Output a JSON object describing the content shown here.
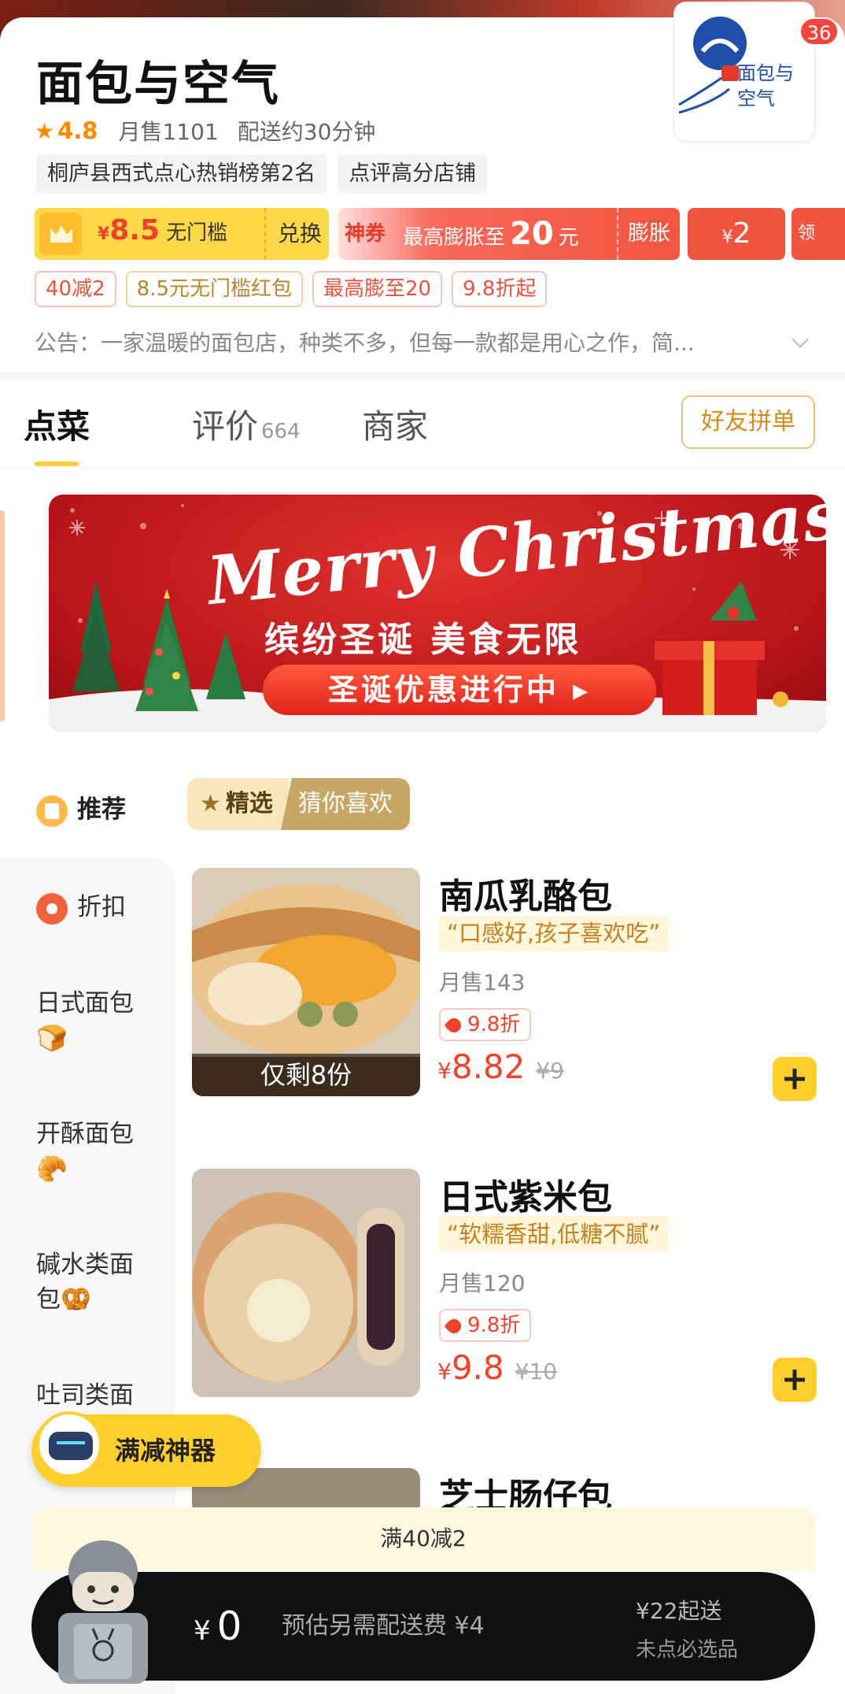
{
  "shop": {
    "name": "面包与空气",
    "rating": "4.8",
    "monthly_sales": "月售1101",
    "delivery_time": "配送约30分钟",
    "logo_badge": "36",
    "logo_text": "面包与空气"
  },
  "rank_tags": [
    "桐庐县西式点心热销榜第2名",
    "点评高分店铺"
  ],
  "coupons": {
    "member": {
      "currency": "¥",
      "amount": "8.5",
      "label": "无门槛",
      "action": "兑换"
    },
    "god_coupon": {
      "badge": "神券",
      "prefix": "最高膨胀至",
      "amount": "20",
      "suffix": "元",
      "action": "膨胀"
    },
    "small": {
      "currency": "¥",
      "amount": "2"
    },
    "peek": "领"
  },
  "promo_tags": [
    "40减2",
    "8.5元无门槛红包",
    "最高膨至20",
    "9.8折起"
  ],
  "notice": "公告：一家温暖的面包店，种类不多，但每一款都是用心之作，简...",
  "tabs": {
    "order": "点菜",
    "reviews": "评价",
    "reviews_count": "664",
    "merchant": "商家",
    "group_button": "好友拼单"
  },
  "banner": {
    "script": "Merry Christmas",
    "subtitle": "缤纷圣诞 美食无限",
    "cta": "圣诞优惠进行中 ▸"
  },
  "sidebar": {
    "items": [
      {
        "label": "推荐",
        "icon": "recommend-icon"
      },
      {
        "label": "折扣",
        "icon": "discount-icon"
      },
      {
        "label": "日式面包",
        "emoji": "🍞"
      },
      {
        "label": "开酥面包",
        "emoji": "🥐"
      },
      {
        "label": "碱水类面",
        "label2": "包",
        "emoji": "🥨"
      },
      {
        "label": "吐司类面"
      }
    ]
  },
  "filters": {
    "selected": "精选",
    "other": "猜你喜欢"
  },
  "items": [
    {
      "name": "南瓜乳酪包",
      "quote": "“口感好,孩子喜欢吃”",
      "sold": "月售143",
      "discount": "9.8折",
      "currency": "¥",
      "price": "8.82",
      "orig": "¥9",
      "remaining": "仅剩8份"
    },
    {
      "name": "日式紫米包",
      "quote": "“软糯香甜,低糖不腻”",
      "sold": "月售120",
      "discount": "9.8折",
      "currency": "¥",
      "price": "9.8",
      "orig": "¥10"
    },
    {
      "name": "芝士肠仔包"
    }
  ],
  "discount_tool": "满减神器",
  "discount_strip": "满40减2",
  "cart": {
    "currency": "¥",
    "amount": "0",
    "fee_note": "预估另需配送费 ¥4",
    "min_order": "¥22起送",
    "must_pick": "未点必选品"
  },
  "colors": {
    "accent": "#ffcf2e",
    "price": "#f0432b",
    "rating": "#ff8a00"
  }
}
